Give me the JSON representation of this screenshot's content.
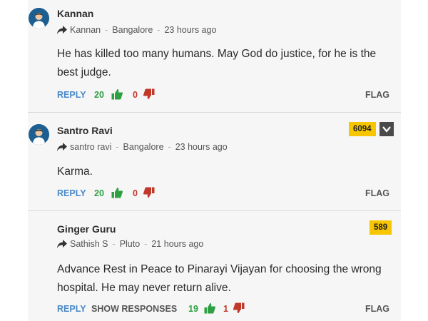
{
  "comments": [
    {
      "author": "Kannan",
      "reply_to": "Kannan",
      "location": "Bangalore",
      "time": "23 hours ago",
      "body": "He has killed too many humans. May God do justice, for he is the best judge.",
      "reply_label": "REPLY",
      "upvotes": "20",
      "downvotes": "0",
      "flag_label": "FLAG"
    },
    {
      "author": "Santro Ravi",
      "reply_to": "santro ravi",
      "location": "Bangalore",
      "time": "23 hours ago",
      "body": "Karma.",
      "reply_label": "REPLY",
      "upvotes": "20",
      "downvotes": "0",
      "flag_label": "FLAG",
      "badge": "6094"
    },
    {
      "author": "Ginger Guru",
      "reply_to": "Sathish S",
      "location": "Pluto",
      "time": "21 hours ago",
      "body": "Advance Rest in Peace to Pinarayi Vijayan for choosing the wrong hospital. He may never return alive.",
      "reply_label": "REPLY",
      "show_responses_label": "SHOW RESPONSES",
      "upvotes": "19",
      "downvotes": "1",
      "flag_label": "FLAG",
      "badge": "589"
    }
  ],
  "colors": {
    "panel_bg": "#f6f6f6",
    "reply_blue": "#4a89c8",
    "upvote_green": "#2ea043",
    "downvote_red": "#c0392b",
    "badge_yellow": "#f7c600",
    "avatar_blue": "#1e5f92"
  },
  "icons": {
    "reply_arrow": "share-arrow-icon",
    "upvote": "thumbs-up-icon",
    "downvote": "thumbs-down-icon",
    "expand": "chevron-down-icon",
    "avatar": "user-avatar-icon"
  }
}
